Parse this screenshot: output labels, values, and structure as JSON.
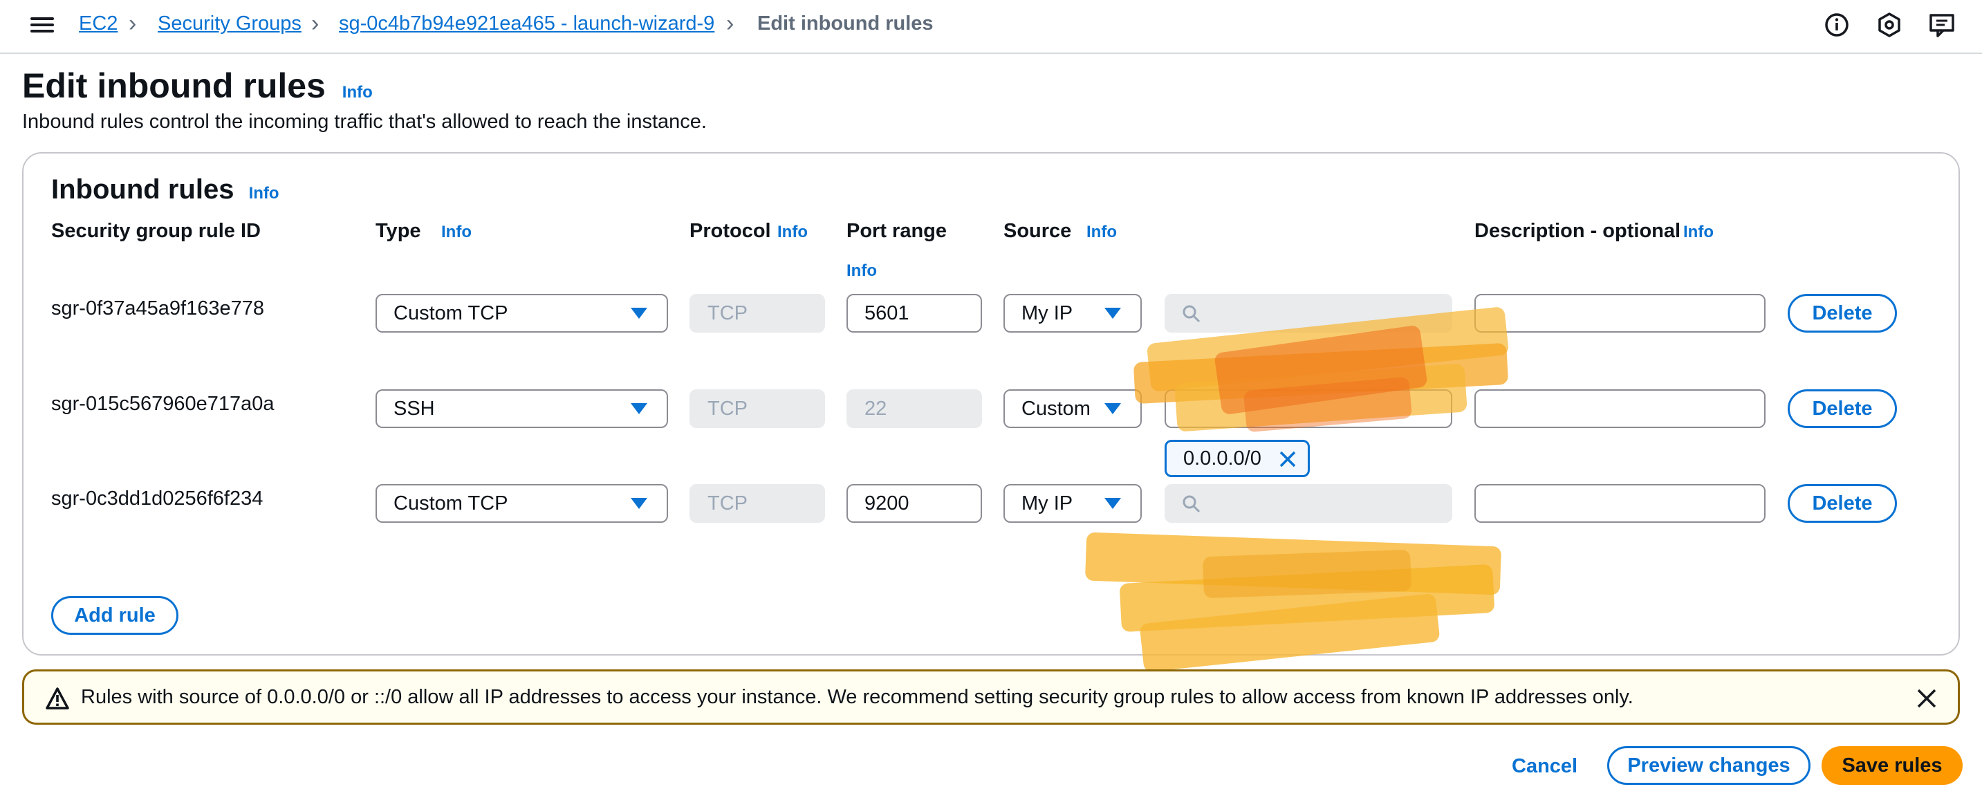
{
  "breadcrumb": {
    "items": [
      "EC2",
      "Security Groups",
      "sg-0c4b7b94e921ea465 - launch-wizard-9"
    ],
    "current": "Edit inbound rules"
  },
  "page": {
    "title": "Edit inbound rules",
    "info": "Info",
    "description": "Inbound rules control the incoming traffic that's allowed to reach the instance."
  },
  "inbound": {
    "title": "Inbound rules",
    "info": "Info",
    "columns": {
      "rule_id": "Security group rule ID",
      "type": "Type",
      "protocol": "Protocol",
      "port_range": "Port range",
      "source": "Source",
      "description": "Description - optional",
      "info": "Info"
    },
    "rules": [
      {
        "id": "sgr-0f37a45a9f163e778",
        "type": "Custom TCP",
        "protocol": "TCP",
        "port": "5601",
        "source": "My IP",
        "description": "",
        "delete": "Delete"
      },
      {
        "id": "sgr-015c567960e717a0a",
        "type": "SSH",
        "protocol": "TCP",
        "port": "22",
        "source": "Custom",
        "cidr_token": "0.0.0.0/0",
        "description": "",
        "delete": "Delete"
      },
      {
        "id": "sgr-0c3dd1d0256f6f234",
        "type": "Custom TCP",
        "protocol": "TCP",
        "port": "9200",
        "source": "My IP",
        "description": "",
        "delete": "Delete"
      }
    ],
    "add_rule": "Add rule"
  },
  "warning": {
    "text": "Rules with source of 0.0.0.0/0 or ::/0 allow all IP addresses to access your instance. We recommend setting security group rules to allow access from known IP addresses only."
  },
  "footer": {
    "cancel": "Cancel",
    "preview": "Preview changes",
    "save": "Save rules"
  },
  "colors": {
    "link": "#0972d3",
    "primary": "#ff9900",
    "warning_border": "#8d6605",
    "redaction": "#f5b324"
  },
  "icons": {
    "menu": "hamburger-icon",
    "separator": "chevron-right-icon",
    "info": "info-circle-icon",
    "settings": "settings-icon",
    "feedback": "feedback-icon",
    "search": "search-icon",
    "dismiss": "close-icon",
    "warning": "warning-triangle-icon"
  }
}
